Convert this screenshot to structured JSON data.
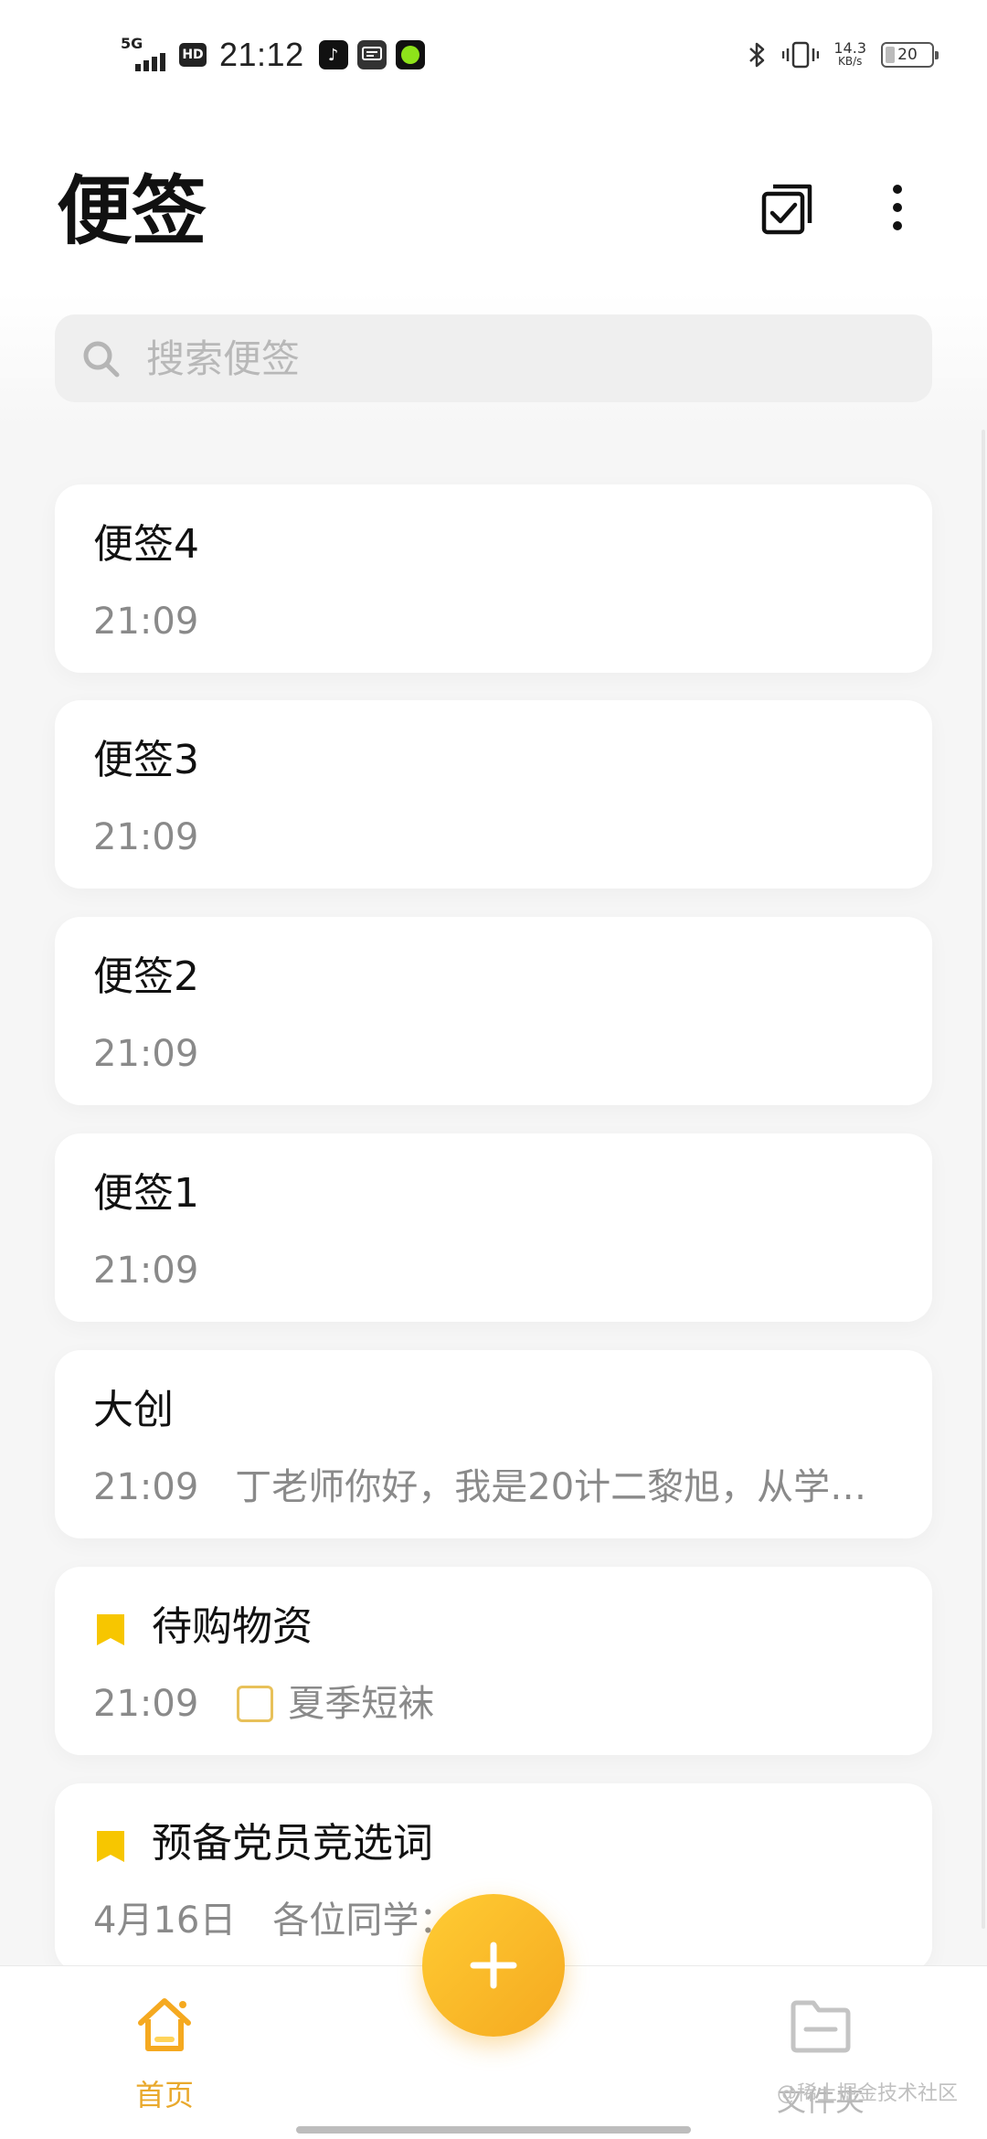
{
  "status_bar": {
    "network": "5G",
    "hd": "HD",
    "time": "21:12",
    "app_tiktok_glyph": "♪",
    "speed_value": "14.3",
    "speed_unit": "KB/s",
    "battery": "20",
    "icons": [
      "signal-icon",
      "hd-icon",
      "tiktok-icon",
      "message-icon",
      "app-icon",
      "bluetooth-icon",
      "vibrate-icon",
      "battery-icon"
    ]
  },
  "header": {
    "title": "便签",
    "icons": [
      "multi-select-icon",
      "more-icon"
    ]
  },
  "search": {
    "placeholder": "搜索便签",
    "value": ""
  },
  "notes": [
    {
      "title": "便签4",
      "time": "21:09",
      "preview": ""
    },
    {
      "title": "便签3",
      "time": "21:09",
      "preview": ""
    },
    {
      "title": "便签2",
      "time": "21:09",
      "preview": ""
    },
    {
      "title": "便签1",
      "time": "21:09",
      "preview": ""
    },
    {
      "title": "大创",
      "time": "21:09",
      "preview": "丁老师你好，我是20计二黎旭，从学…"
    },
    {
      "title": "待购物资",
      "time": "21:09",
      "checklist_item": "夏季短袜",
      "bookmarked": true
    },
    {
      "title": "预备党员竞选词",
      "time": "4月16日",
      "preview": "各位同学：",
      "bookmarked": true
    }
  ],
  "bottom_nav": {
    "home_label": "首页",
    "folder_label": "文件夹",
    "fab_label": "+"
  },
  "watermark": "@稀土掘金技术社区",
  "colors": {
    "accent": "#f5a920",
    "accent_light": "#ffcc33",
    "bookmark": "#f7c600",
    "text_primary": "#111111",
    "text_secondary": "#8a8a8a",
    "background": "#f6f6f6"
  }
}
